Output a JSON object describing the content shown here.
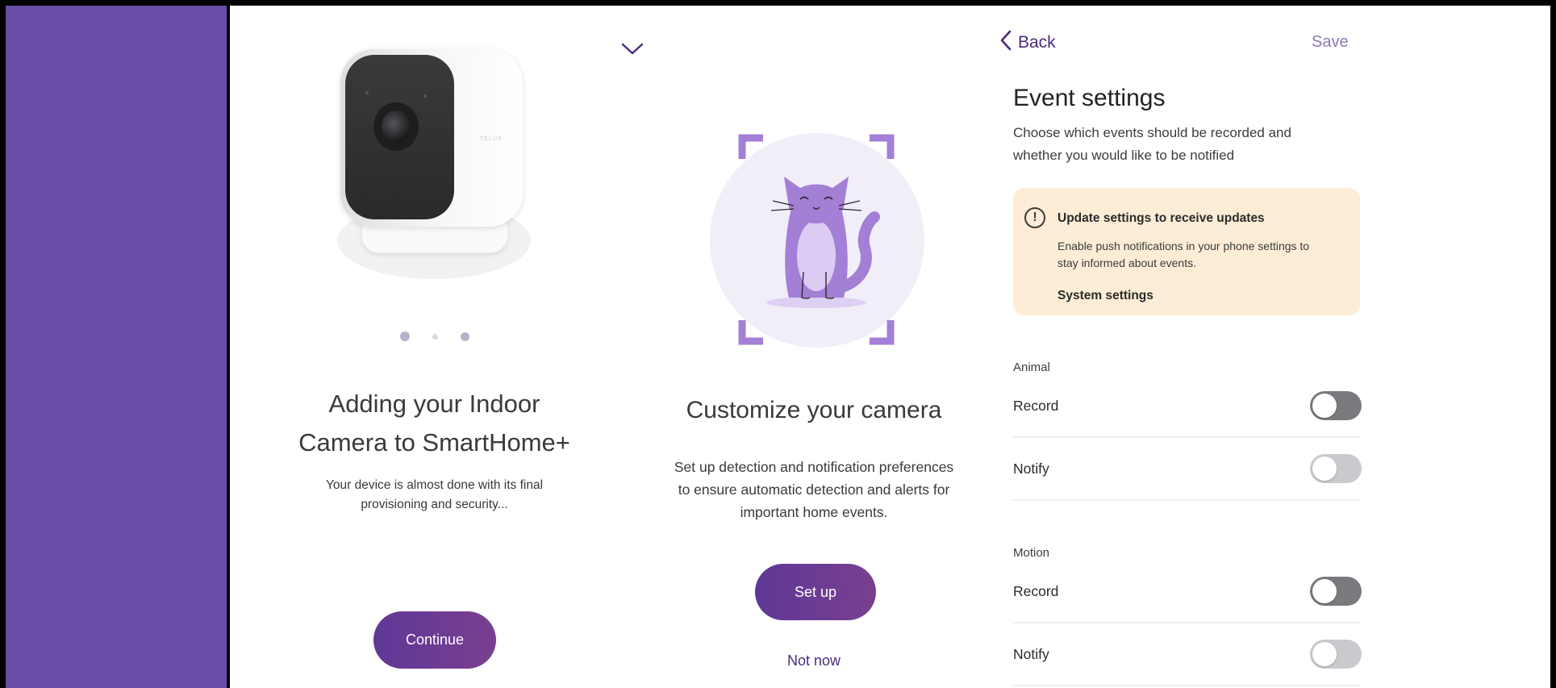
{
  "panel1": {
    "title_line1": "Adding your Indoor",
    "title_line2": "Camera to SmartHome+",
    "desc_line1": "Your device is almost done with its final",
    "desc_line2": "provisioning and security...",
    "continue_label": "Continue",
    "carousel": {
      "count": 3,
      "active_index": 0
    },
    "camera_logo": "TELUS"
  },
  "panel2": {
    "title": "Customize your camera",
    "desc_line1": "Set up detection and notification preferences",
    "desc_line2": "to ensure automatic detection and alerts for",
    "desc_line3": "important home events.",
    "setup_label": "Set up",
    "not_now_label": "Not now"
  },
  "panel3": {
    "back_label": "Back",
    "save_label": "Save",
    "title": "Event settings",
    "subtitle_line1": "Choose which events should be recorded and",
    "subtitle_line2": "whether you would like to be notified",
    "alert": {
      "title": "Update settings to receive updates",
      "text_line1": "Enable push notifications in your phone settings to",
      "text_line2": "stay informed about events.",
      "link": "System settings"
    },
    "sections": [
      {
        "label": "Animal",
        "rows": [
          {
            "label": "Record",
            "on": false
          },
          {
            "label": "Notify",
            "on": false
          }
        ]
      },
      {
        "label": "Motion",
        "rows": [
          {
            "label": "Record",
            "on": false
          },
          {
            "label": "Notify",
            "on": false
          }
        ]
      }
    ]
  },
  "colors": {
    "sidebar": "#684ea6",
    "primary_button": "#5e3897",
    "link": "#4a2b7d",
    "alert_bg": "#fdecd6",
    "illustration": "#a47fd6"
  }
}
